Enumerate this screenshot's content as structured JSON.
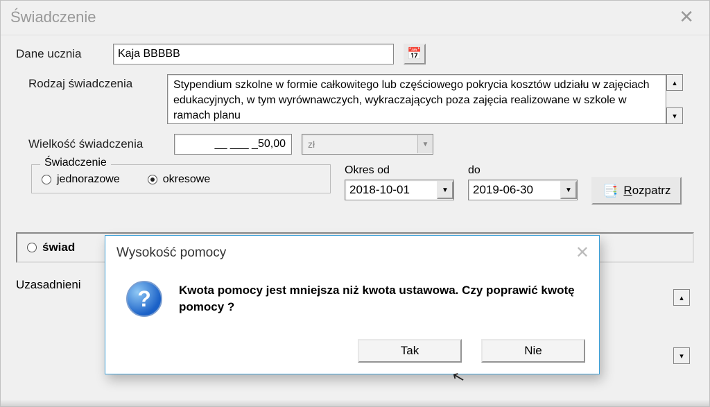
{
  "window": {
    "title": "Świadczenie"
  },
  "student": {
    "label": "Dane ucznia",
    "value": "Kaja BBBBB"
  },
  "rodzaj": {
    "label": "Rodzaj świadczenia",
    "text": "Stypendium szkolne w formie całkowitego lub częściowego pokrycia kosztów udziału w zajęciach edukacyjnych, w tym wyrównawczych, wykraczających poza zajęcia realizowane w szkole w ramach planu"
  },
  "wielkosc": {
    "label": "Wielkość świadczenia",
    "value": "__ ___ _50,00",
    "currency": "zł"
  },
  "typGroup": {
    "legend": "Świadczenie",
    "opt1": "jednorazowe",
    "opt2": "okresowe"
  },
  "okres": {
    "od_label": "Okres od",
    "do_label": "do",
    "od": "2018-10-01",
    "do": "2019-06-30"
  },
  "rozpatrz": {
    "label": "Rozpatrz"
  },
  "swiadczRadio": {
    "label": "świad"
  },
  "uzasadnienie": {
    "label": "Uzasadnieni"
  },
  "modal": {
    "title": "Wysokość pomocy",
    "message": "Kwota pomocy jest mniejsza niż kwota ustawowa. Czy poprawić kwotę pomocy ?",
    "yes": "Tak",
    "no": "Nie"
  }
}
